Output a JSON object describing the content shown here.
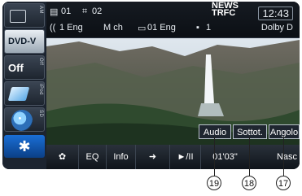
{
  "sidebar": {
    "sources": [
      {
        "label": "",
        "side": "AM"
      },
      {
        "label": "DVD-V",
        "side": "DVD"
      },
      {
        "label": "Off",
        "side": "Off"
      },
      {
        "label": "",
        "side": "iPod"
      },
      {
        "label": "",
        "side": "SD"
      },
      {
        "label": "",
        "side": "Audio"
      }
    ]
  },
  "status": {
    "title_num": "01",
    "chapter_num": "02",
    "audio": "1 Eng",
    "channel": "M ch",
    "subtitle": "01 Eng",
    "angle": "1",
    "format": "Dolby D",
    "news": "NEWS",
    "trfc": "TRFC",
    "clock": "12:43"
  },
  "video_buttons": {
    "audio": "Audio",
    "subtitle": "Sottot.",
    "angle": "Angolo"
  },
  "toolbar": {
    "eq": "EQ",
    "info": "Info",
    "play_pause": "►/II",
    "time": "01'03\"",
    "hide": "Nasc"
  },
  "callouts": {
    "c19": "19",
    "c18": "18",
    "c17": "17"
  }
}
